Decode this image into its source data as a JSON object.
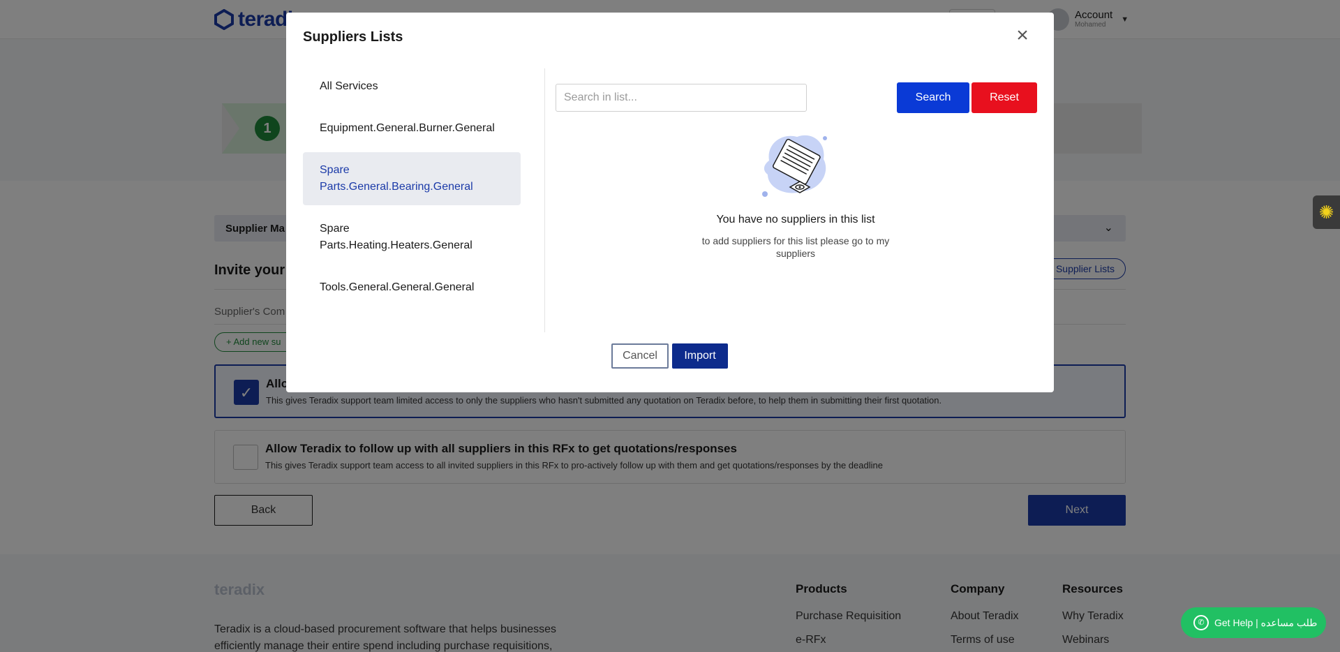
{
  "background": {
    "brand": "teradix",
    "account": {
      "label": "Account",
      "sub": "Mohamed"
    },
    "step_number": "1",
    "section_title": "Supplier Ma",
    "invite_title": "Invite your su",
    "supplier_lists_label": "Supplier Lists",
    "company_label": "Supplier's Com",
    "add_new_label": "+ Add new su",
    "allow_options": [
      {
        "title": "Allo",
        "desc": "This gives Teradix support team limited access to only the suppliers who hasn't submitted any quotation on Teradix before, to help them in submitting their first quotation.",
        "checked": true
      },
      {
        "title": "Allow Teradix to follow up with all suppliers in this RFx to get quotations/responses",
        "desc": "This gives Teradix support team access to all invited suppliers in this RFx to pro-actively follow up with them and get quotations/responses by the deadline",
        "checked": false
      }
    ],
    "back_label": "Back",
    "next_label": "Next",
    "footer": {
      "logo": "teradix",
      "about": "Teradix is a cloud-based procurement software that helps businesses efficiently manage their entire spend including purchase requisitions,",
      "columns": [
        {
          "title": "Products",
          "items": [
            "Purchase Requisition",
            "e-RFx"
          ]
        },
        {
          "title": "Company",
          "items": [
            "About Teradix",
            "Terms of use"
          ]
        },
        {
          "title": "Resources",
          "items": [
            "Why Teradix",
            "Webinars"
          ]
        }
      ]
    },
    "help_label": "Get Help | طلب مساعده"
  },
  "modal": {
    "title": "Suppliers Lists",
    "lists": [
      {
        "label": "All Services",
        "selected": false
      },
      {
        "label": "Equipment.General.Burner.General",
        "selected": false
      },
      {
        "label": "Spare Parts.General.Bearing.General",
        "selected": true
      },
      {
        "label": "Spare Parts.Heating.Heaters.General",
        "selected": false
      },
      {
        "label": "Tools.General.General.General",
        "selected": false
      }
    ],
    "search": {
      "placeholder": "Search in list...",
      "value": ""
    },
    "search_label": "Search",
    "reset_label": "Reset",
    "empty_title": "You have no suppliers in this list",
    "empty_desc": "to add suppliers for this list please go to my suppliers",
    "cancel_label": "Cancel",
    "import_label": "Import"
  },
  "colors": {
    "brand_blue": "#1b3aa8",
    "search_blue": "#0a3ad6",
    "reset_red": "#e8101e",
    "import_navy": "#0d2b8c",
    "success_green": "#1f8a3a",
    "help_green": "#21c063"
  },
  "icons": {
    "close": "close-icon",
    "check": "check-icon",
    "empty_state": "document-illustration-icon",
    "whatsapp": "whatsapp-icon",
    "widget": "sun-icon"
  }
}
